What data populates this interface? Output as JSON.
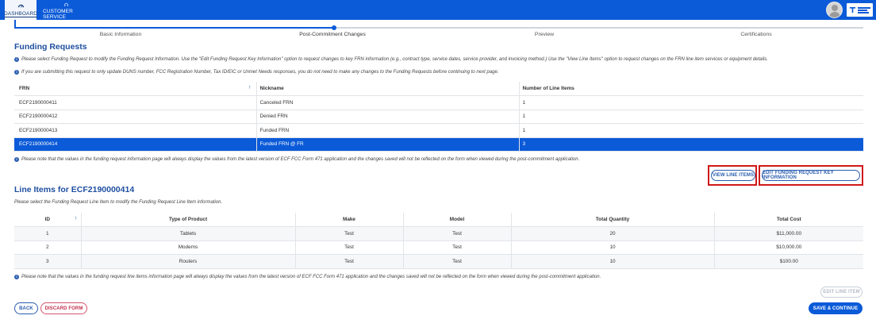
{
  "nav": {
    "dashboard": "DASHBOARD",
    "customer_service": "CUSTOMER SERVICE"
  },
  "stepper": {
    "steps": [
      "Basic Information",
      "Post-Commitment Changes",
      "Preview",
      "Certifications"
    ],
    "active_index": 1
  },
  "funding_requests": {
    "title": "Funding Requests",
    "info1": "Please select Funding Request to modify the Funding Request Information. Use the \"Edit Funding Request Key Information\" option to request changes to key FRN information (e.g., contract type, service dates, service provider, and invoicing method.) Use the \"View Line Items\" option to request changes on the FRN line item services or equipment details.",
    "info2": "If you are submitting this request to only update DUNS number, FCC Registration Number, Tax ID/EIC or Unmet Needs responses, you do not need to make any changes to the Funding Requests before continuing to next page.",
    "columns": [
      "FRN",
      "Nickname",
      "Number of Line Items"
    ],
    "sort_glyph": "↑",
    "rows": [
      {
        "frn": "ECF2190000411",
        "nickname": "Canceled FRN",
        "count": "1"
      },
      {
        "frn": "ECF2190000412",
        "nickname": "Denied FRN",
        "count": "1"
      },
      {
        "frn": "ECF2190000413",
        "nickname": "Funded FRN",
        "count": "1"
      },
      {
        "frn": "ECF2190000414",
        "nickname": "Funded FRN @ FR",
        "count": "3"
      }
    ],
    "note": "Please note that the values in the funding request information page will always display the values from the latest version of ECF FCC Form 471 application and the changes saved will not be reflected on the form when viewed during the post-commitment application.",
    "view_line_items": "VIEW LINE ITEMS",
    "edit_key_info": "EDIT FUNDING REQUEST KEY INFORMATION"
  },
  "line_items": {
    "title": "Line Items for ECF2190000414",
    "instruction": "Please select the Funding Request Line Item to modify the Funding Request Line Item information.",
    "columns": [
      "ID",
      "Type of Product",
      "Make",
      "Model",
      "Total Quantity",
      "Total Cost"
    ],
    "sort_glyph": "↑",
    "rows": [
      {
        "id": "1",
        "type": "Tablets",
        "make": "Test",
        "model": "Test",
        "qty": "20",
        "cost": "$11,000.00"
      },
      {
        "id": "2",
        "type": "Modems",
        "make": "Test",
        "model": "Test",
        "qty": "10",
        "cost": "$10,000.00"
      },
      {
        "id": "3",
        "type": "Routers",
        "make": "Test",
        "model": "Test",
        "qty": "10",
        "cost": "$100.00"
      }
    ],
    "note": "Please note that the values in the funding request line items information page will always display the values from the latest version of ECF FCC Form 471 application and the changes saved will not be reflected on the form when viewed during the post-commitment application.",
    "edit_line_item": "EDIT LINE ITEM"
  },
  "footer": {
    "back": "BACK",
    "discard": "DISCARD FORM",
    "save": "SAVE & CONTINUE"
  },
  "info_glyph": "i",
  "colors": {
    "primary": "#0b5ad8",
    "title": "#1f4fa0",
    "highlight": "#d01818",
    "danger": "#c3324f"
  }
}
